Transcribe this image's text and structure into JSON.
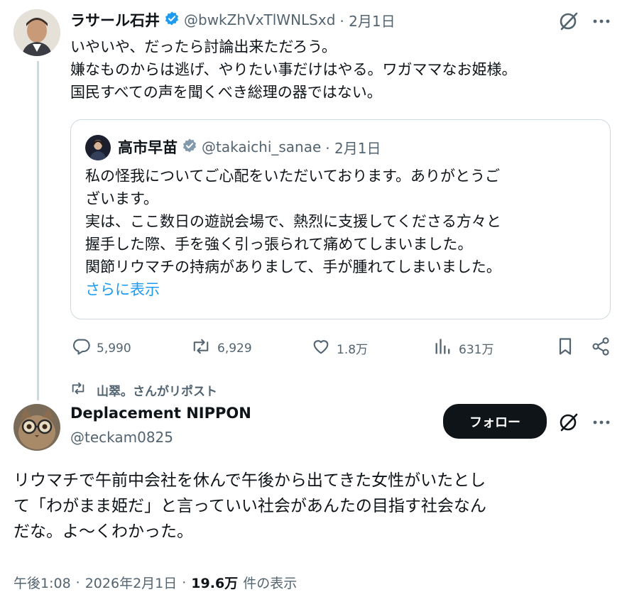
{
  "parent_post": {
    "author_name": "ラサール石井",
    "handle": "@bwkZhVxTlWNLSxd",
    "date": "· 2月1日",
    "text_lines": [
      "いやいや、だったら討論出来ただろう。",
      "嫌なものからは逃げ、やりたい事だけはやる。ワガママなお姫様。",
      "国民すべての声を聞くべき総理の器ではない。"
    ],
    "quoted": {
      "author_name": "高市早苗",
      "handle": "@takaichi_sanae",
      "date": "· 2月1日",
      "text_lines": [
        "私の怪我についてご心配をいただいております。ありがとうご",
        "ざいます。",
        "実は、ここ数日の遊説会場で、熱烈に支援してくださる方々と",
        "握手した際、手を強く引っ張られて痛めてしまいました。",
        "関節リウマチの持病がありまして、手が腫れてしまいました。"
      ],
      "show_more": "さらに表示"
    },
    "metrics": {
      "replies": "5,990",
      "reposts": "6,929",
      "likes": "1.8万",
      "views": "631万"
    }
  },
  "repost_context": "山翠。さんがリポスト",
  "main_post": {
    "author_name": "Deplacement NIPPON",
    "handle": "@teckam0825",
    "follow_label": "フォロー",
    "text_lines": [
      "リウマチで午前中会社を休んで午後から出てきた女性がいたとし",
      "て「わがまま姫だ」と言っていい社会があんたの目指す社会なん",
      "だな。よ〜くわかった。"
    ],
    "time": "午後1:08",
    "sep1": "·",
    "date": "2026年2月1日",
    "sep2": "·",
    "views_count": "19.6万",
    "views_label": "件の表示"
  },
  "colors": {
    "text": "#0f1419",
    "muted": "#536471",
    "link": "#1d9bf0",
    "border": "#cfd9de",
    "verified": "#1d9bf0"
  }
}
